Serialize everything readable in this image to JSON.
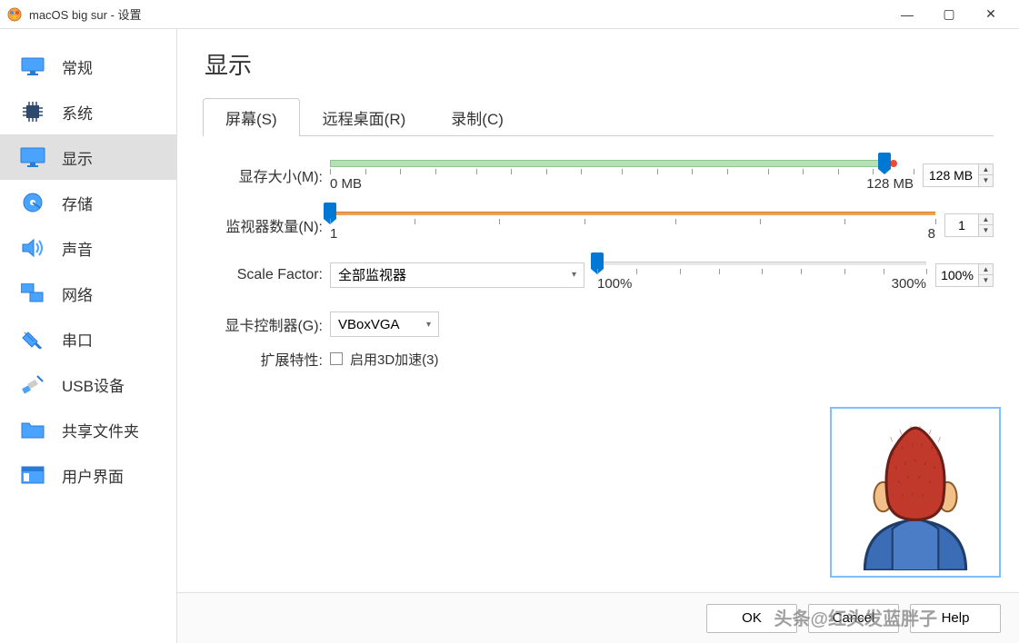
{
  "window": {
    "title": "macOS big sur - 设置"
  },
  "sidebar": {
    "items": [
      {
        "label": "常规",
        "icon": "monitor"
      },
      {
        "label": "系统",
        "icon": "chip"
      },
      {
        "label": "显示",
        "icon": "display",
        "selected": true
      },
      {
        "label": "存储",
        "icon": "disk"
      },
      {
        "label": "声音",
        "icon": "speaker"
      },
      {
        "label": "网络",
        "icon": "network"
      },
      {
        "label": "串口",
        "icon": "serial"
      },
      {
        "label": "USB设备",
        "icon": "usb"
      },
      {
        "label": "共享文件夹",
        "icon": "folder"
      },
      {
        "label": "用户界面",
        "icon": "ui"
      }
    ]
  },
  "page": {
    "title": "显示"
  },
  "tabs": [
    {
      "label": "屏幕(S)",
      "active": true
    },
    {
      "label": "远程桌面(R)"
    },
    {
      "label": "录制(C)"
    }
  ],
  "form": {
    "vram": {
      "label": "显存大小(M):",
      "min_label": "0 MB",
      "max_label": "128 MB",
      "value_text": "128 MB",
      "pos_pct": 95
    },
    "monitors": {
      "label": "监视器数量(N):",
      "min_label": "1",
      "max_label": "8",
      "value_text": "1",
      "pos_pct": 0
    },
    "scale": {
      "label": "Scale Factor:",
      "dropdown": "全部监视器",
      "min_label": "100%",
      "max_label": "300%",
      "value_text": "100%",
      "pos_pct": 0
    },
    "controller": {
      "label": "显卡控制器(G):",
      "value": "VBoxVGA"
    },
    "ext": {
      "label": "扩展特性:",
      "checkbox_label": "启用3D加速(3)"
    }
  },
  "footer": {
    "ok": "OK",
    "cancel": "Cancel",
    "help": "Help"
  },
  "watermark": "头条@红头发蓝胖子"
}
